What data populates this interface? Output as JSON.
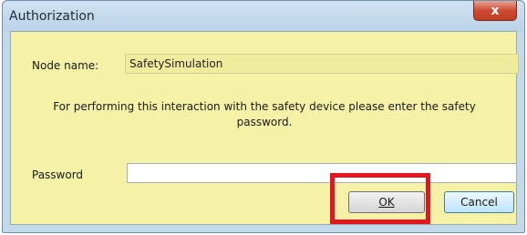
{
  "window": {
    "title": "Authorization",
    "close_glyph": "x"
  },
  "dialog": {
    "node_name_label": "Node name:",
    "node_name_value": "SafetySimulation",
    "message": "For performing this interaction with the safety device please enter the safety password.",
    "password_label": "Password",
    "password_value": "",
    "ok_label": "OK",
    "cancel_label": "Cancel"
  },
  "colors": {
    "highlight": "#e3161e",
    "client_background": "#f5f1a6"
  }
}
